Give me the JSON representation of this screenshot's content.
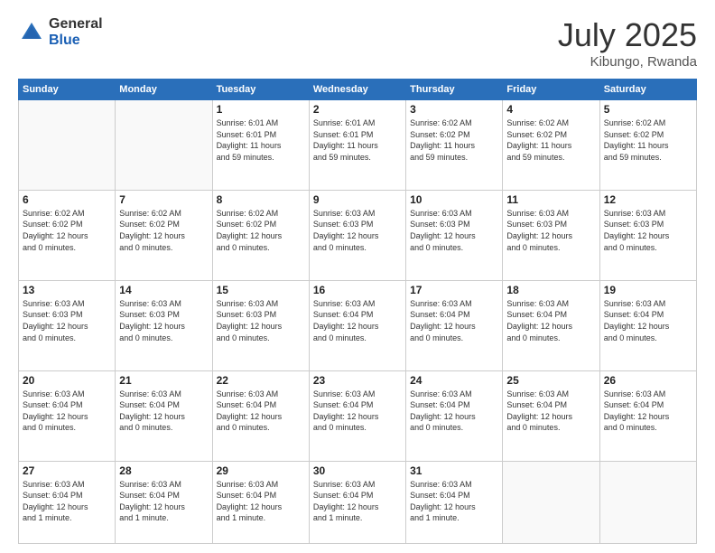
{
  "logo": {
    "general": "General",
    "blue": "Blue"
  },
  "title": {
    "month_year": "July 2025",
    "location": "Kibungo, Rwanda"
  },
  "weekdays": [
    "Sunday",
    "Monday",
    "Tuesday",
    "Wednesday",
    "Thursday",
    "Friday",
    "Saturday"
  ],
  "weeks": [
    [
      {
        "day": "",
        "info": ""
      },
      {
        "day": "",
        "info": ""
      },
      {
        "day": "1",
        "info": "Sunrise: 6:01 AM\nSunset: 6:01 PM\nDaylight: 11 hours\nand 59 minutes."
      },
      {
        "day": "2",
        "info": "Sunrise: 6:01 AM\nSunset: 6:01 PM\nDaylight: 11 hours\nand 59 minutes."
      },
      {
        "day": "3",
        "info": "Sunrise: 6:02 AM\nSunset: 6:02 PM\nDaylight: 11 hours\nand 59 minutes."
      },
      {
        "day": "4",
        "info": "Sunrise: 6:02 AM\nSunset: 6:02 PM\nDaylight: 11 hours\nand 59 minutes."
      },
      {
        "day": "5",
        "info": "Sunrise: 6:02 AM\nSunset: 6:02 PM\nDaylight: 11 hours\nand 59 minutes."
      }
    ],
    [
      {
        "day": "6",
        "info": "Sunrise: 6:02 AM\nSunset: 6:02 PM\nDaylight: 12 hours\nand 0 minutes."
      },
      {
        "day": "7",
        "info": "Sunrise: 6:02 AM\nSunset: 6:02 PM\nDaylight: 12 hours\nand 0 minutes."
      },
      {
        "day": "8",
        "info": "Sunrise: 6:02 AM\nSunset: 6:02 PM\nDaylight: 12 hours\nand 0 minutes."
      },
      {
        "day": "9",
        "info": "Sunrise: 6:03 AM\nSunset: 6:03 PM\nDaylight: 12 hours\nand 0 minutes."
      },
      {
        "day": "10",
        "info": "Sunrise: 6:03 AM\nSunset: 6:03 PM\nDaylight: 12 hours\nand 0 minutes."
      },
      {
        "day": "11",
        "info": "Sunrise: 6:03 AM\nSunset: 6:03 PM\nDaylight: 12 hours\nand 0 minutes."
      },
      {
        "day": "12",
        "info": "Sunrise: 6:03 AM\nSunset: 6:03 PM\nDaylight: 12 hours\nand 0 minutes."
      }
    ],
    [
      {
        "day": "13",
        "info": "Sunrise: 6:03 AM\nSunset: 6:03 PM\nDaylight: 12 hours\nand 0 minutes."
      },
      {
        "day": "14",
        "info": "Sunrise: 6:03 AM\nSunset: 6:03 PM\nDaylight: 12 hours\nand 0 minutes."
      },
      {
        "day": "15",
        "info": "Sunrise: 6:03 AM\nSunset: 6:03 PM\nDaylight: 12 hours\nand 0 minutes."
      },
      {
        "day": "16",
        "info": "Sunrise: 6:03 AM\nSunset: 6:04 PM\nDaylight: 12 hours\nand 0 minutes."
      },
      {
        "day": "17",
        "info": "Sunrise: 6:03 AM\nSunset: 6:04 PM\nDaylight: 12 hours\nand 0 minutes."
      },
      {
        "day": "18",
        "info": "Sunrise: 6:03 AM\nSunset: 6:04 PM\nDaylight: 12 hours\nand 0 minutes."
      },
      {
        "day": "19",
        "info": "Sunrise: 6:03 AM\nSunset: 6:04 PM\nDaylight: 12 hours\nand 0 minutes."
      }
    ],
    [
      {
        "day": "20",
        "info": "Sunrise: 6:03 AM\nSunset: 6:04 PM\nDaylight: 12 hours\nand 0 minutes."
      },
      {
        "day": "21",
        "info": "Sunrise: 6:03 AM\nSunset: 6:04 PM\nDaylight: 12 hours\nand 0 minutes."
      },
      {
        "day": "22",
        "info": "Sunrise: 6:03 AM\nSunset: 6:04 PM\nDaylight: 12 hours\nand 0 minutes."
      },
      {
        "day": "23",
        "info": "Sunrise: 6:03 AM\nSunset: 6:04 PM\nDaylight: 12 hours\nand 0 minutes."
      },
      {
        "day": "24",
        "info": "Sunrise: 6:03 AM\nSunset: 6:04 PM\nDaylight: 12 hours\nand 0 minutes."
      },
      {
        "day": "25",
        "info": "Sunrise: 6:03 AM\nSunset: 6:04 PM\nDaylight: 12 hours\nand 0 minutes."
      },
      {
        "day": "26",
        "info": "Sunrise: 6:03 AM\nSunset: 6:04 PM\nDaylight: 12 hours\nand 0 minutes."
      }
    ],
    [
      {
        "day": "27",
        "info": "Sunrise: 6:03 AM\nSunset: 6:04 PM\nDaylight: 12 hours\nand 1 minute."
      },
      {
        "day": "28",
        "info": "Sunrise: 6:03 AM\nSunset: 6:04 PM\nDaylight: 12 hours\nand 1 minute."
      },
      {
        "day": "29",
        "info": "Sunrise: 6:03 AM\nSunset: 6:04 PM\nDaylight: 12 hours\nand 1 minute."
      },
      {
        "day": "30",
        "info": "Sunrise: 6:03 AM\nSunset: 6:04 PM\nDaylight: 12 hours\nand 1 minute."
      },
      {
        "day": "31",
        "info": "Sunrise: 6:03 AM\nSunset: 6:04 PM\nDaylight: 12 hours\nand 1 minute."
      },
      {
        "day": "",
        "info": ""
      },
      {
        "day": "",
        "info": ""
      }
    ]
  ]
}
